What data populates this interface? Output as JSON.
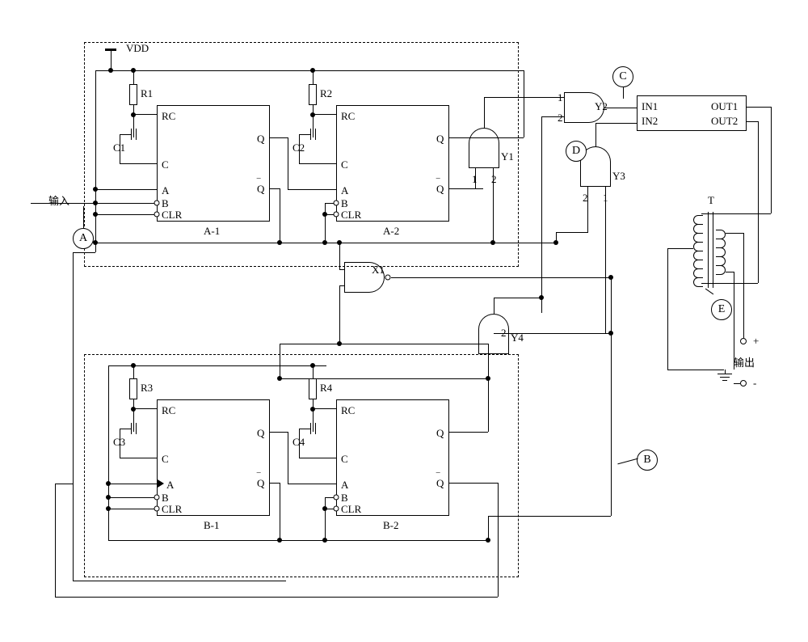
{
  "power": "VDD",
  "resistors": [
    "R1",
    "R2",
    "R3",
    "R4"
  ],
  "caps": [
    "C1",
    "C2",
    "C3",
    "C4"
  ],
  "mono": {
    "a1": {
      "name": "A-1",
      "pins": {
        "rc": "RC",
        "c": "C",
        "a": "A",
        "b": "B",
        "clr": "CLR",
        "q": "Q",
        "qb": "Q"
      }
    },
    "a2": {
      "name": "A-2",
      "pins": {
        "rc": "RC",
        "c": "C",
        "a": "A",
        "b": "B",
        "clr": "CLR",
        "q": "Q",
        "qb": "Q"
      }
    },
    "b1": {
      "name": "B-1",
      "pins": {
        "rc": "RC",
        "c": "C",
        "a": "A",
        "b": "B",
        "clr": "CLR",
        "q": "Q",
        "qb": "Q"
      }
    },
    "b2": {
      "name": "B-2",
      "pins": {
        "rc": "RC",
        "c": "C",
        "a": "A",
        "b": "B",
        "clr": "CLR",
        "q": "Q",
        "qb": "Q"
      }
    }
  },
  "gates": {
    "y1": "Y1",
    "y2": "Y2",
    "y3": "Y3",
    "y4": "Y4",
    "x1": "X1"
  },
  "pin_nums": {
    "one": "1",
    "two": "2"
  },
  "driver": {
    "in1": "IN1",
    "in2": "IN2",
    "out1": "OUT1",
    "out2": "OUT2"
  },
  "transformer": "T",
  "io": {
    "in": "输入",
    "out": "输出"
  },
  "nodes": {
    "A": "A",
    "B": "B",
    "C": "C",
    "D": "D",
    "E": "E"
  },
  "signs": {
    "plus": "+",
    "minus": "-"
  },
  "qbar_overline": "‾"
}
